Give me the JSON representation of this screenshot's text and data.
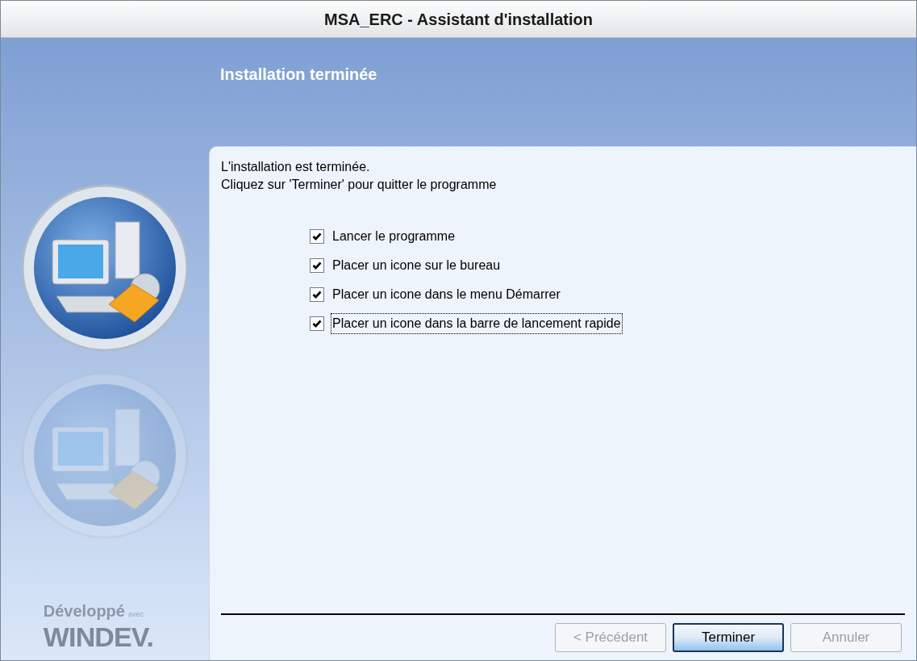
{
  "window": {
    "title": "MSA_ERC - Assistant d'installation"
  },
  "header": {
    "title": "Installation terminée"
  },
  "message": [
    "L'installation est terminée.",
    "Cliquez sur 'Terminer' pour quitter le programme"
  ],
  "options": [
    {
      "label": "Lancer le programme",
      "checked": true,
      "focused": false
    },
    {
      "label": "Placer un icone sur le bureau",
      "checked": true,
      "focused": false
    },
    {
      "label": "Placer un icone dans le menu Démarrer",
      "checked": true,
      "focused": false
    },
    {
      "label": "Placer un icone dans la barre de lancement rapide",
      "checked": true,
      "focused": true
    }
  ],
  "branding": {
    "line_1": "Développé",
    "small": "avec",
    "line_2": "WINDEV."
  },
  "buttons": [
    {
      "label": "< Précédent",
      "disabled": true,
      "default": false
    },
    {
      "label": "Terminer",
      "disabled": false,
      "default": true
    },
    {
      "label": "Annuler",
      "disabled": true,
      "default": false
    }
  ]
}
